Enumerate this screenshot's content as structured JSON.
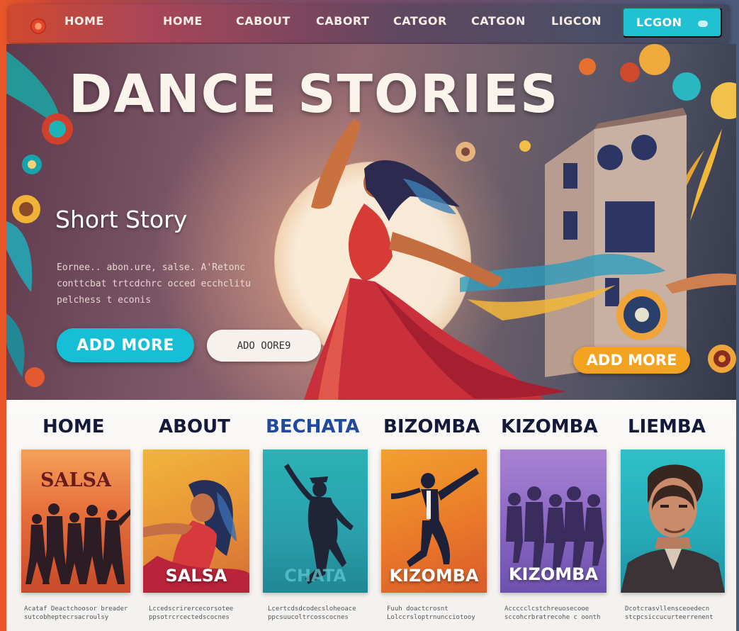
{
  "nav": {
    "items": [
      "HOME",
      "HOME",
      "CABOUT",
      "CABORT",
      "CATGOR",
      "CATGON",
      "LIGCON"
    ],
    "login_label": "LCGON"
  },
  "hero": {
    "title": "DANCE STORIES",
    "subtitle": "Short Story",
    "body_lines": [
      "Eornee.. abon.ure, salse. A'Retonc",
      "conttcbat trtcdchrc occed ecchclitu",
      "pelchess t econis"
    ],
    "primary_button": "ADD MORE",
    "secondary_button": "ADO OORE9",
    "accent_button": "ADD MORE"
  },
  "categories": {
    "labels": [
      "HOME",
      "ABOUT",
      "BECHATA",
      "BIZOMBA",
      "KIZOMBA",
      "LIEMBA"
    ],
    "cards": [
      {
        "top_caption": "SALSA",
        "caption": ""
      },
      {
        "top_caption": "",
        "caption": "SALSA"
      },
      {
        "top_caption": "",
        "caption": "CHATA"
      },
      {
        "top_caption": "",
        "caption": "KIZOMBA"
      },
      {
        "top_caption": "",
        "caption": "KIZOMBA"
      },
      {
        "top_caption": "",
        "caption": ""
      }
    ],
    "descriptions": [
      [
        "Acataf Deactchoosor breader",
        "sutcobheptecrsacroulsy"
      ],
      [
        "Lccedscrirercecorsotee",
        "ppsotrcrcectedscocnes"
      ],
      [
        "Lcertcdsdcodecsloheoace",
        "ppcsuucoltrcosscocnes"
      ],
      [
        "Fuuh doactcrosnt",
        "Lolccrsloptrnuncciotooy"
      ],
      [
        "Accccclcstchreuosecooe",
        "sccohcrbratrecohe c oonth"
      ],
      [
        "Dcotcrasvllensceoedecn",
        "stcpcsiccucurteerrenent"
      ]
    ]
  },
  "colors": {
    "accent_cyan": "#17bfd6",
    "accent_orange": "#f3a31f",
    "label_navy": "#151a3a",
    "bechata_blue": "#1f4aa0"
  }
}
